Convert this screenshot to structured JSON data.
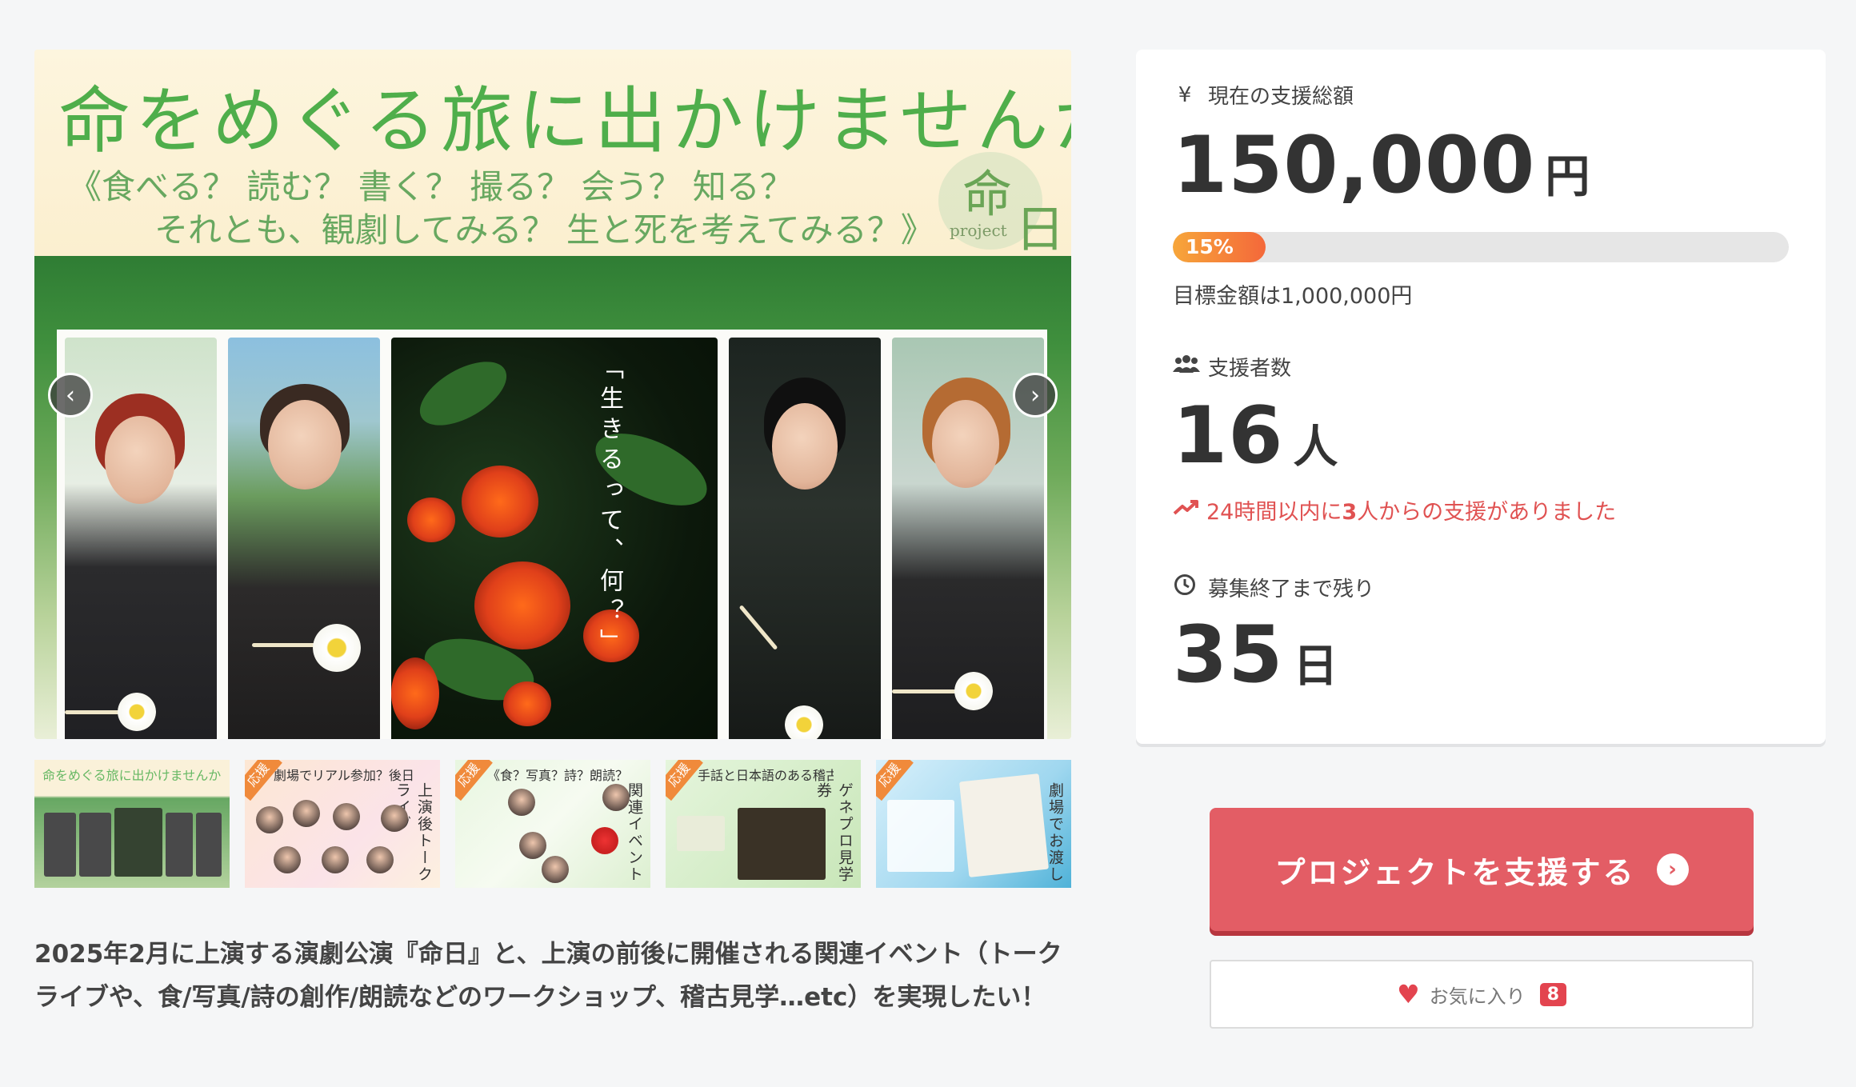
{
  "hero": {
    "title": "命をめぐる旅に出かけませんか？",
    "subtitle_line1": "《食べる？ 読む？ 書く？ 撮る？ 会う？ 知る？",
    "subtitle_line2": "それとも、観劇してみる？ 生と死を考えてみる？》",
    "logo_kanji_1": "命",
    "logo_kanji_2": "日",
    "logo_word": "project",
    "photo_caption": "「生きるって、何？」"
  },
  "carousel": {
    "prev_icon": "chevron-left-icon",
    "next_icon": "chevron-right-icon"
  },
  "thumbnails": [
    {
      "title": "命をめぐる旅に出かけませんか？",
      "tag": "",
      "side": ""
    },
    {
      "title": "劇場でリアル参加？後日配信で視聴する？",
      "tag": "応援",
      "side": "上演後トークライブ"
    },
    {
      "title": "《食？写真？詩？朗読？》",
      "tag": "応援",
      "side": "関連イベント"
    },
    {
      "title": "手話と日本語のある稽古",
      "tag": "応援",
      "side": "ゲネプロ見学券"
    },
    {
      "title": "",
      "tag": "応援",
      "side": "劇場でお渡し"
    }
  ],
  "description": "2025年2月に上演する演劇公演『命日』と、上演の前後に開催される関連イベント（トークライブや、食/写真/詩の創作/朗読などのワークショップ、稽古見学…etc）を実現したい！",
  "stats": {
    "amount_label": "現在の支援総額",
    "amount_value": "150,000",
    "amount_unit": "円",
    "progress_label": "15%",
    "progress_fraction": 0.15,
    "goal_text": "目標金額は1,000,000円",
    "supporters_label": "支援者数",
    "supporters_value": "16",
    "supporters_unit": "人",
    "trend_prefix": "24時間以内に",
    "trend_count": "3",
    "trend_suffix": "人からの支援がありました",
    "remaining_label": "募集終了まで残り",
    "remaining_value": "35",
    "remaining_unit": "日"
  },
  "actions": {
    "support_button": "プロジェクトを支援する",
    "favorite_label": "お気に入り",
    "favorite_count": "8"
  },
  "colors": {
    "accent": "#e35d65",
    "progress_start": "#f7a63a",
    "progress_end": "#f4683a",
    "trend": "#e05252",
    "hero_title": "#4fae4b"
  }
}
